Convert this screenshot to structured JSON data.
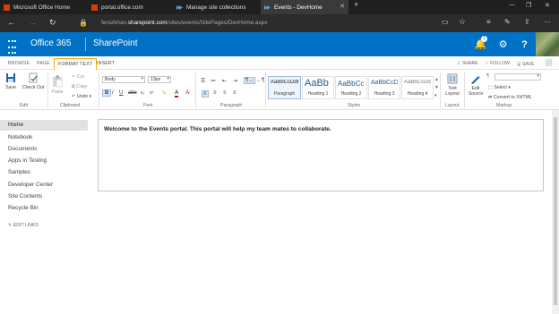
{
  "browser": {
    "tabs": [
      {
        "label": "Microsoft Office Home",
        "icon": "office-icon",
        "color": "#d83b01"
      },
      {
        "label": "portal.office.com",
        "icon": "office-icon",
        "color": "#d83b01"
      },
      {
        "label": "Manage site collections",
        "icon": "sharepoint-icon",
        "color": "#4aa3df"
      },
      {
        "label": "Events - DevHome",
        "icon": "sharepoint-icon",
        "color": "#4aa3df"
      }
    ],
    "new_tab": "+",
    "url_prefix": "ferozkhan.",
    "url_domain": "sharepoint.com",
    "url_path": "/sites/events/SitePages/DevHome.aspx"
  },
  "suitebar": {
    "app": "Office 365",
    "site": "SharePoint",
    "notification_count": "1",
    "bg": "#0072c6"
  },
  "ribbon_tabs": [
    "BROWSE",
    "PAGE",
    "FORMAT TEXT",
    "INSERT"
  ],
  "page_actions": {
    "share": "SHARE",
    "follow": "FOLLOW",
    "save": "SAVE"
  },
  "ribbon": {
    "edit": {
      "save": "Save",
      "checkout": "Check Out",
      "group": "Edit"
    },
    "clipboard": {
      "paste": "Paste",
      "cut": "Cut",
      "copy": "Copy",
      "undo": "Undo",
      "group": "Clipboard"
    },
    "font": {
      "family": "Body",
      "size": "13px",
      "group": "Font"
    },
    "paragraph": {
      "group": "Paragraph"
    },
    "styles": {
      "group": "Styles",
      "items": [
        {
          "preview": "AaBbCcDdE",
          "name": "Paragraph"
        },
        {
          "preview": "AaBb",
          "name": "Heading 1"
        },
        {
          "preview": "AaBbCc",
          "name": "Heading 2"
        },
        {
          "preview": "AaBbCcDc",
          "name": "Heading 3"
        },
        {
          "preview": "AaBbCcDdE",
          "name": "Heading 4"
        }
      ]
    },
    "layout": {
      "text_layout": "Text Layout",
      "group": "Layout"
    },
    "markup": {
      "edit_source": "Edit Source",
      "select": "Select",
      "convert": "Convert to XHTML",
      "group": "Markup"
    }
  },
  "leftnav": {
    "items": [
      "Home",
      "Notebook",
      "Documents",
      "Apps in Testing",
      "Samples",
      "Developer Center",
      "Site Contents",
      "Recycle Bin"
    ],
    "edit_links": "EDIT LINKS"
  },
  "editor": {
    "content": "Welcome to the Events portal. This portal will help my team mates to collaborate."
  }
}
